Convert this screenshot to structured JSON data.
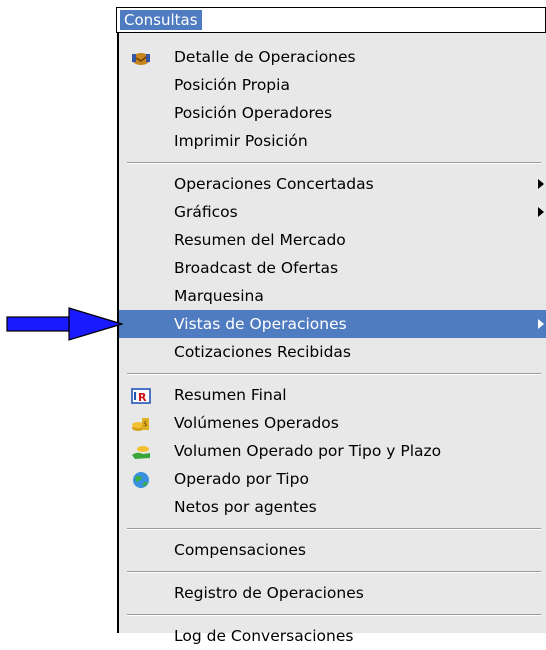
{
  "menubar": {
    "title": "Consultas"
  },
  "groups": [
    [
      {
        "label": "Detalle de Operaciones",
        "icon": "handshake-icon"
      },
      {
        "label": "Posición Propia"
      },
      {
        "label": "Posición Operadores"
      },
      {
        "label": "Imprimir Posición"
      }
    ],
    [
      {
        "label": "Operaciones Concertadas",
        "submenu": true
      },
      {
        "label": "Gráficos",
        "submenu": true
      },
      {
        "label": "Resumen del Mercado"
      },
      {
        "label": "Broadcast de Ofertas"
      },
      {
        "label": "Marquesina"
      },
      {
        "label": "Vistas de Operaciones",
        "submenu": true,
        "highlighted": true
      },
      {
        "label": "Cotizaciones Recibidas"
      }
    ],
    [
      {
        "label": "Resumen Final",
        "icon": "report-r-icon"
      },
      {
        "label": "Volúmenes Operados",
        "icon": "coins-icon"
      },
      {
        "label": "Volumen Operado por Tipo y Plazo",
        "icon": "hand-coins-icon"
      },
      {
        "label": "Operado por Tipo",
        "icon": "globe-icon"
      },
      {
        "label": "Netos por agentes"
      }
    ],
    [
      {
        "label": "Compensaciones"
      }
    ],
    [
      {
        "label": "Registro de Operaciones"
      }
    ],
    [
      {
        "label": "Log de Conversaciones"
      }
    ]
  ],
  "colors": {
    "highlight": "#4f7cc0",
    "menu_bg": "#e8e8e8",
    "pointer": "#1a1aff"
  }
}
